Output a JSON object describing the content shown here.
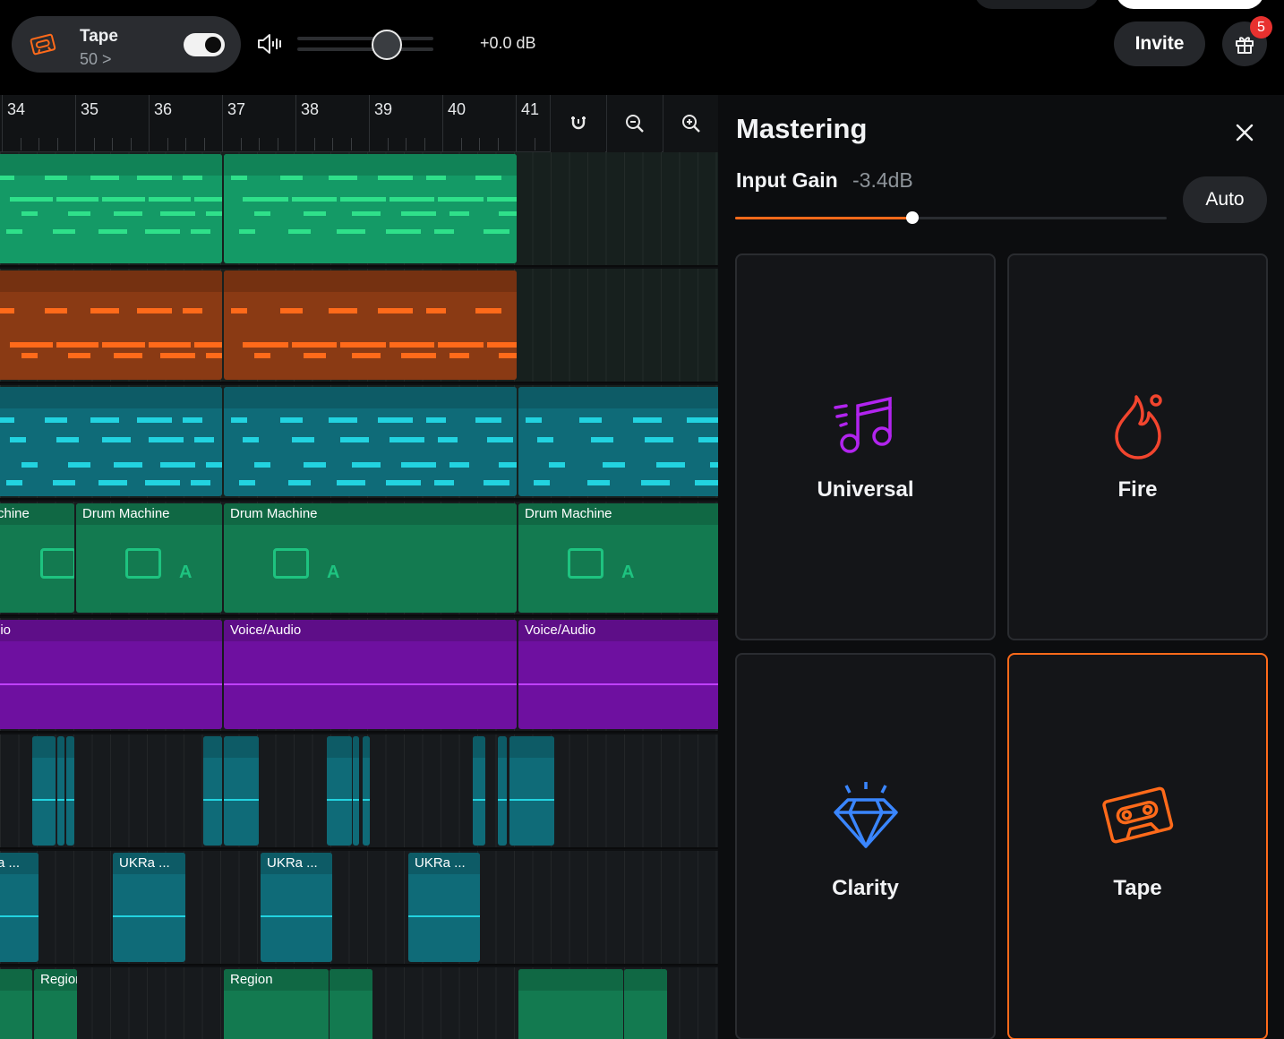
{
  "topbar": {
    "preset_name": "Tape",
    "preset_amount": "50 >",
    "preset_enabled": true,
    "volume_readout": "+0.0 dB",
    "volume_level": 0.66,
    "invite_label": "Invite",
    "gift_badge_count": "5"
  },
  "timeline": {
    "bar_numbers": [
      "34",
      "35",
      "36",
      "37",
      "38",
      "39",
      "40",
      "41"
    ],
    "tools": [
      "magnet-icon",
      "zoom-out-icon",
      "zoom-in-icon"
    ],
    "tracks": [
      {
        "kind": "midi",
        "color": "#149a66",
        "regions": [
          {
            "title": ""
          },
          {
            "title": ""
          }
        ]
      },
      {
        "kind": "midi",
        "color": "#8a3a14",
        "regions": [
          {
            "title": ""
          },
          {
            "title": ""
          }
        ]
      },
      {
        "kind": "midi",
        "color": "#0f6b78",
        "regions": [
          {
            "title": ""
          },
          {
            "title": ""
          },
          {
            "title": ""
          }
        ]
      },
      {
        "kind": "drum",
        "color": "#137a50",
        "regions": [
          {
            "title": "chine"
          },
          {
            "title": "Drum Machine"
          },
          {
            "title": "Drum Machine"
          },
          {
            "title": "Drum Machine"
          }
        ]
      },
      {
        "kind": "audio",
        "color": "#6e10a0",
        "regions": [
          {
            "title": "lio"
          },
          {
            "title": "Voice/Audio"
          },
          {
            "title": "Voice/Audio"
          }
        ]
      },
      {
        "kind": "sample",
        "color": "#0f6b78",
        "regions": []
      },
      {
        "kind": "sample",
        "color": "#0f6b78",
        "regions": [
          {
            "title": "a ..."
          },
          {
            "title": "UKRa ..."
          },
          {
            "title": "UKRa ..."
          },
          {
            "title": "UKRa ..."
          }
        ]
      },
      {
        "kind": "audio",
        "color": "#137a50",
        "regions": [
          {
            "title": ""
          },
          {
            "title": "Region"
          },
          {
            "title": "Region"
          }
        ]
      }
    ]
  },
  "mastering": {
    "title": "Mastering",
    "input_gain_label": "Input Gain",
    "input_gain_value": "-3.4dB",
    "input_gain_level": 0.41,
    "auto_label": "Auto",
    "styles": [
      {
        "label": "Universal",
        "icon": "music-notes-icon",
        "color": "#b224ef",
        "selected": false
      },
      {
        "label": "Fire",
        "icon": "flame-icon",
        "color": "#f2452e",
        "selected": false
      },
      {
        "label": "Clarity",
        "icon": "diamond-icon",
        "color": "#3a86ff",
        "selected": false
      },
      {
        "label": "Tape",
        "icon": "cassette-icon",
        "color": "#ff6a1a",
        "selected": true
      }
    ]
  }
}
